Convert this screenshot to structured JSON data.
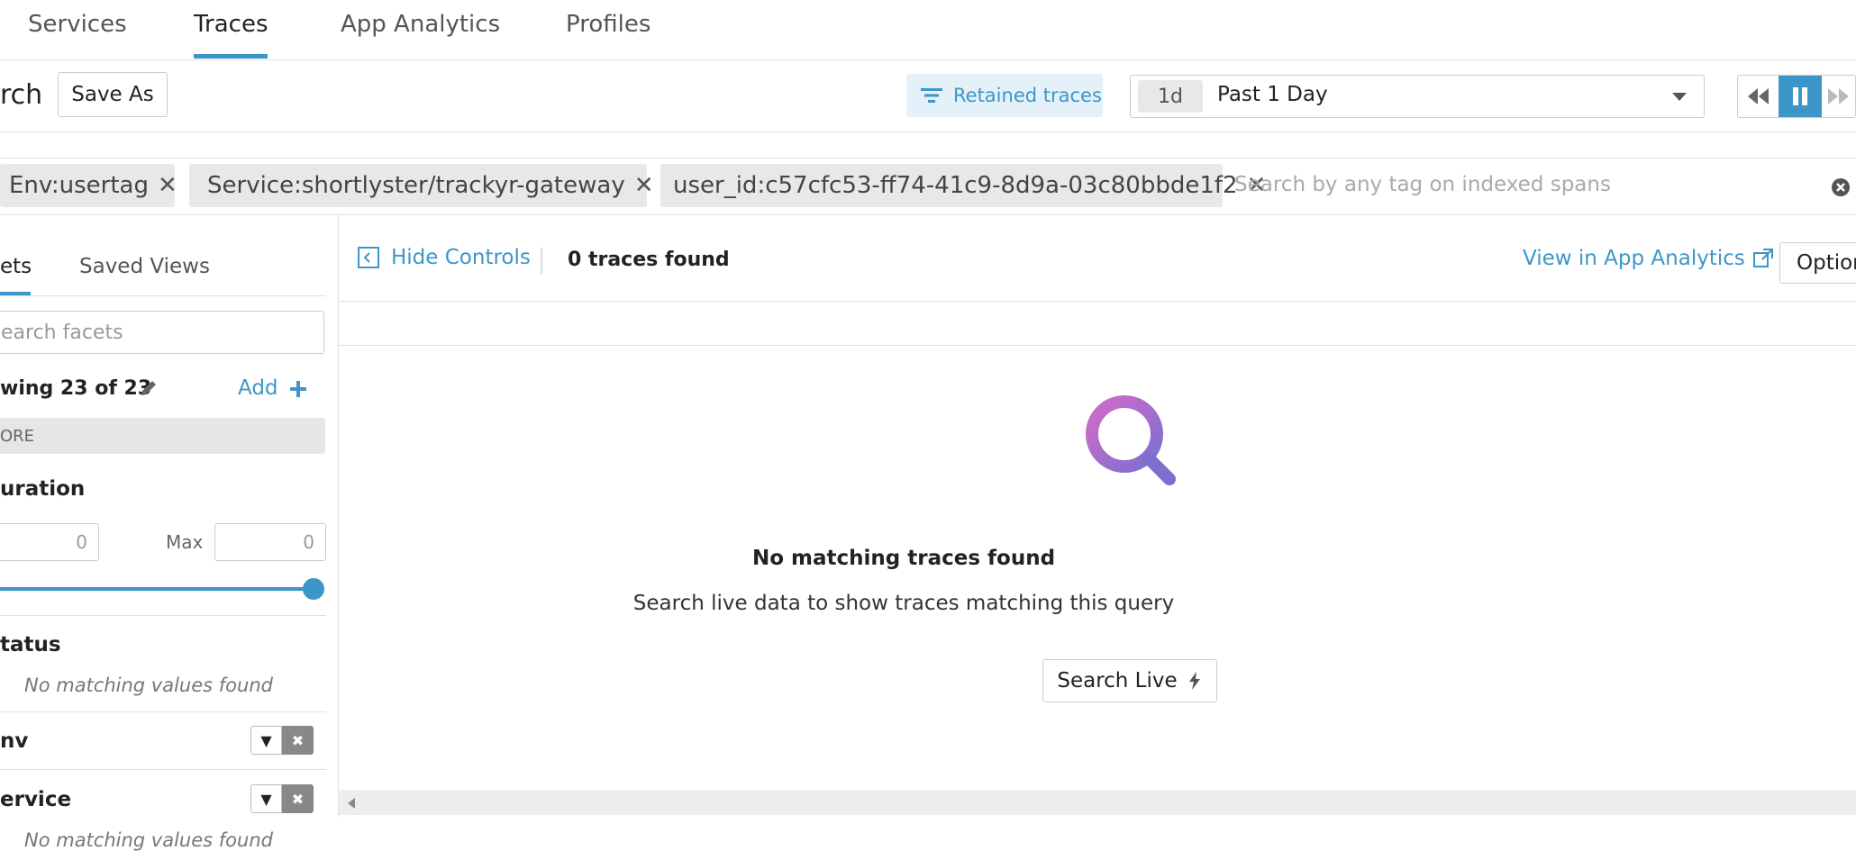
{
  "nav": {
    "tabs": [
      {
        "label": "Services"
      },
      {
        "label": "Traces"
      },
      {
        "label": "App Analytics"
      },
      {
        "label": "Profiles"
      }
    ],
    "active": "Traces",
    "accent": "#3c96c8"
  },
  "header": {
    "title_partial": "rch",
    "save_as": "Save As",
    "retained_traces": "Retained traces",
    "time_badge": "1d",
    "time_range": "Past 1 Day"
  },
  "filters": {
    "chips": [
      {
        "label": "Env:usertag"
      },
      {
        "label": "Service:shortlyster/trackyr-gateway"
      },
      {
        "label": "user_id:c57cfc53-ff74-41c9-8d9a-03c80bbde1f2"
      }
    ],
    "search_placeholder": "Search by any tag on indexed spans"
  },
  "sidebar": {
    "tab_facets": "ets",
    "tab_saved_views": "Saved Views",
    "search_placeholder": "earch facets",
    "showing": "wing 23 of 23",
    "add_label": "Add",
    "core_label": "ORE",
    "duration": {
      "title": "uration",
      "min_value": "0",
      "max_label": "Max",
      "max_value": "0"
    },
    "status": {
      "title": "tatus",
      "empty": "No matching values found"
    },
    "env": {
      "title": "nv"
    },
    "service": {
      "title": "ervice",
      "empty": "No matching values found"
    }
  },
  "main": {
    "hide_controls": "Hide Controls",
    "count": "0 traces found",
    "view_in_analytics": "View in App Analytics",
    "options": "Option",
    "empty_title": "No matching traces found",
    "empty_subtitle": "Search live data to show traces matching this query",
    "search_live": "Search Live"
  }
}
